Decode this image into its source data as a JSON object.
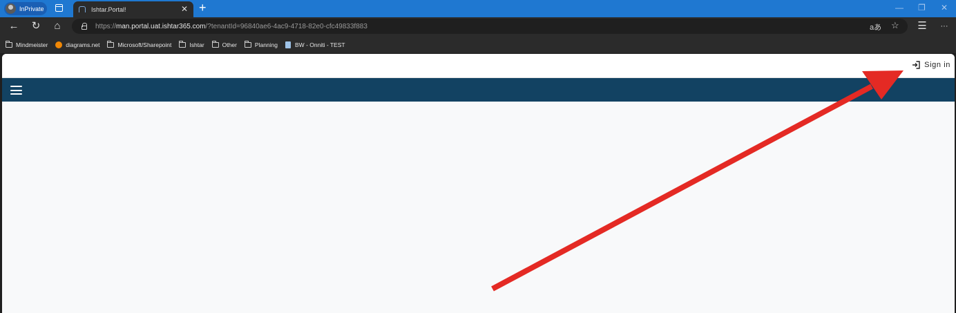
{
  "browser": {
    "inprivate_label": "InPrivate",
    "tab_title": "Ishtar.Portal!",
    "tab_close": "✕",
    "new_tab": "+",
    "window_controls": [
      "—",
      "❐",
      "✕"
    ]
  },
  "navbar": {
    "back": "←",
    "refresh": "↻",
    "home": "⌂",
    "url_scheme": "https://",
    "url_host": "man.portal.uat.ishtar365.com",
    "url_rest": "/?tenantId=96840ae6-4ac9-4718-82e0-cfc49833f883",
    "read_aloud": "aあ",
    "favorite": "☆",
    "favorites_bar": "☰",
    "more": "···"
  },
  "bookmarks": [
    {
      "label": "Mindmeister",
      "icon": "folder-icon"
    },
    {
      "label": "diagrams.net",
      "icon": "drawio-icon"
    },
    {
      "label": "Microsoft/Sharepoint",
      "icon": "folder-icon"
    },
    {
      "label": "Ishtar",
      "icon": "folder-icon"
    },
    {
      "label": "Other",
      "icon": "folder-icon"
    },
    {
      "label": "Planning",
      "icon": "folder-icon"
    },
    {
      "label": "BW - Onniti - TEST",
      "icon": "doc-icon"
    }
  ],
  "page": {
    "signin_label": "Sign in",
    "navbar_color": "#124262",
    "annotation_color": "#e42a24"
  }
}
